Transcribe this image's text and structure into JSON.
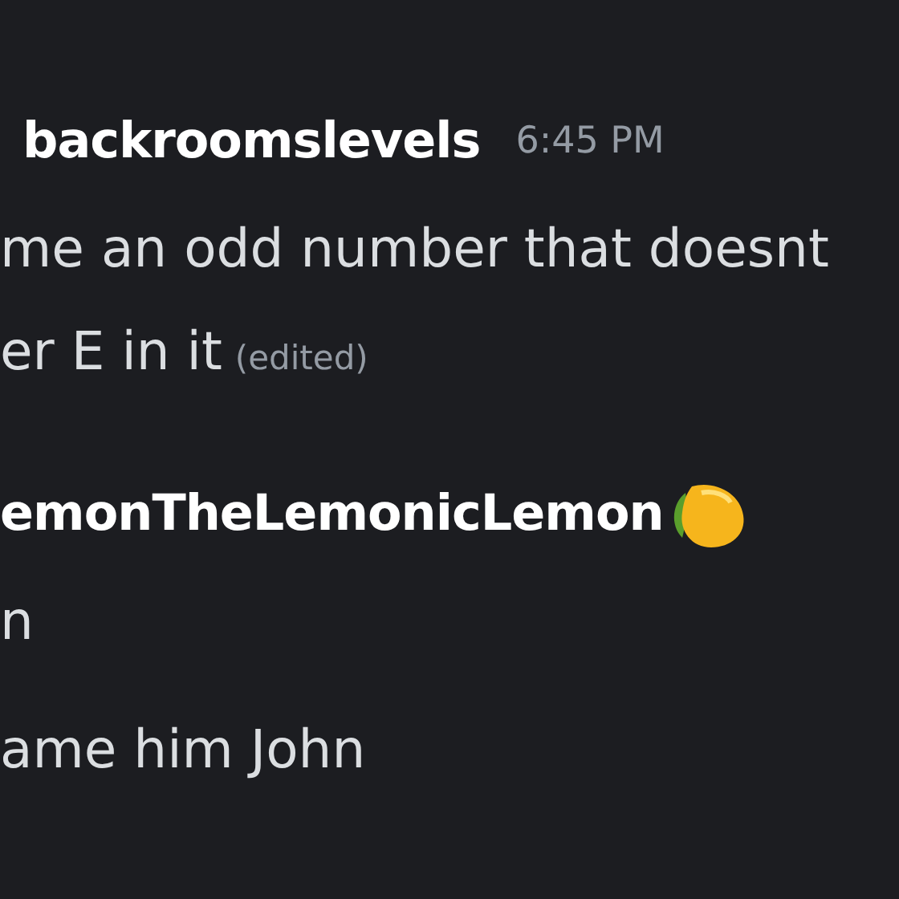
{
  "messages": [
    {
      "author": "backroomslevels",
      "time": "6:45 PM",
      "lines": [
        {
          "text": "me an odd number that doesnt",
          "edited": false
        },
        {
          "text": "er E in it",
          "edited": true
        }
      ]
    },
    {
      "author": "emonTheLemonicLemon",
      "emoji": true,
      "lines": [
        {
          "text": "n",
          "edited": false
        },
        {
          "text": "ame him John",
          "edited": false
        }
      ]
    }
  ],
  "edited_label": "(edited)"
}
